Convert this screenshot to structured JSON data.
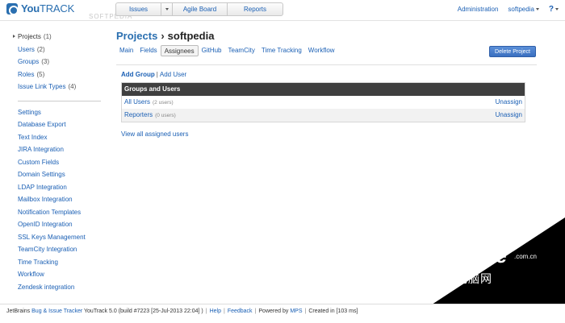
{
  "app": {
    "logo_text_bold": "You",
    "logo_text": "TRACK",
    "watermark_top": "SOFTPEDIA"
  },
  "topnav": {
    "items": [
      "Issues",
      "",
      "Agile Board",
      "Reports"
    ]
  },
  "topright": {
    "administration": "Administration",
    "user": "softpedia",
    "help": "?"
  },
  "sidebar": {
    "group1": [
      {
        "label": "Projects",
        "count": "(1)",
        "active": true
      },
      {
        "label": "Users",
        "count": "(2)"
      },
      {
        "label": "Groups",
        "count": "(3)"
      },
      {
        "label": "Roles",
        "count": "(5)"
      },
      {
        "label": "Issue Link Types",
        "count": "(4)"
      }
    ],
    "group2": [
      "Settings",
      "Database Export",
      "Text Index",
      "JIRA Integration",
      "Custom Fields",
      "Domain Settings",
      "LDAP Integration",
      "Mailbox Integration",
      "Notification Templates",
      "OpenID Integration",
      "SSL Keys Management",
      "TeamCity Integration",
      "Time Tracking",
      "Workflow",
      "Zendesk integration"
    ]
  },
  "page": {
    "crumb": "Projects",
    "sep": "›",
    "current": "softpedia"
  },
  "tabs": [
    "Main",
    "Fields",
    "Assignees",
    "GitHub",
    "TeamCity",
    "Time Tracking",
    "Workflow"
  ],
  "active_tab": "Assignees",
  "delete_button": "Delete Project",
  "actions": {
    "add_group": "Add Group",
    "pipe": "|",
    "add_user": "Add User"
  },
  "grid": {
    "header": "Groups and Users",
    "rows": [
      {
        "name": "All Users",
        "meta": "(2 users)",
        "action": "Unassign"
      },
      {
        "name": "Reporters",
        "meta": "(0 users)",
        "action": "Unassign"
      }
    ]
  },
  "view_all": "View all assigned users",
  "footer": {
    "jetbrains": "JetBrains",
    "tracker_link": "Bug & Issue Tracker",
    "build": "YouTrack 5.0 (build #7223 [25-Jul-2013 22:04] )",
    "help": "Help",
    "feedback": "Feedback",
    "powered": "Powered by",
    "mps": "MPS",
    "created": "Created in [103 ms]"
  },
  "watermark": {
    "text": "PConline",
    "dot": ".com.cn",
    "cn": "太平洋电脑网"
  },
  "colors": {
    "link": "#1a5fb4",
    "accent": "#2a6fb0",
    "grid_header": "#3f3f3f"
  }
}
